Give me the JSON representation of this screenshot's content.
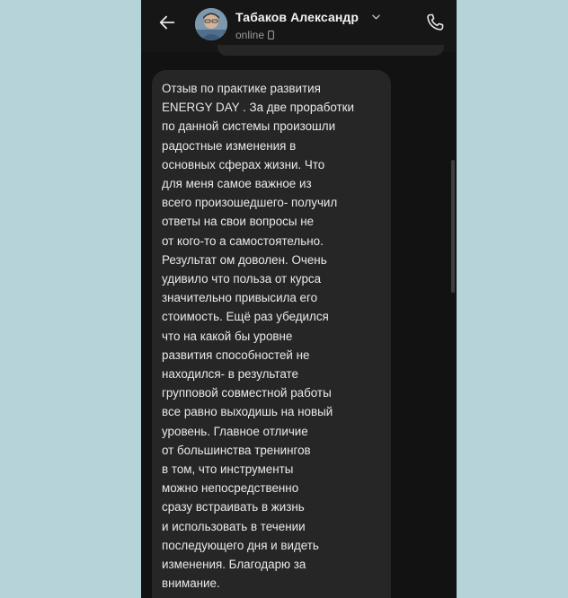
{
  "header": {
    "contact_name": "Табаков Александр",
    "status": "online"
  },
  "message": {
    "lines": [
      "Отзыв по практике развития",
      "ENERGY DAY . За две проработки",
      "по данной системы произошли",
      "радостные изменения в",
      "основных сферах жизни. Что",
      "для меня самое важное из",
      "всего произошедшего- получил",
      "ответы на свои вопросы не",
      "от кого-то а самостоятельно.",
      "Результат ом доволен. Очень",
      "удивило что польза от курса",
      "значительно привысила его",
      "стоимость. Ещё раз убедился",
      "что на какой бы уровне",
      "развития способностей не",
      "находился- в результате",
      "групповой совместной работы",
      "все равно выходишь на новый",
      "уровень. Главное отличие",
      "от большинства тренингов",
      "в том, что инструменты",
      "можно непосредственно",
      "сразу встраивать в жизнь",
      "и использовать в течении",
      "последующего дня и видеть",
      "изменения. Благодарю за",
      "внимание."
    ]
  },
  "icons": {
    "back": "arrow-left-icon",
    "expand": "chevron-down-icon",
    "device": "mobile-phone-icon",
    "call": "phone-call-icon"
  },
  "colors": {
    "page_background": "#b7d3da",
    "chat_background": "#121212",
    "bubble_background": "#262626",
    "text": "#e9e9e9"
  }
}
